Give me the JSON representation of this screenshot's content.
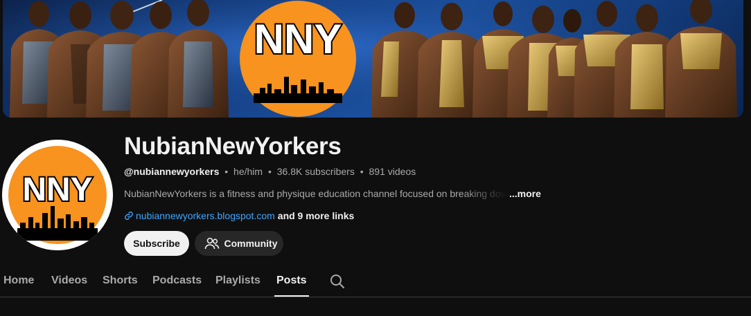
{
  "banner": {
    "logo_text": "NNY",
    "colors": {
      "sky": "#1c55a8",
      "logo_orange": "#f7931e"
    }
  },
  "avatar": {
    "logo_text": "NNY",
    "colors": {
      "logo_orange": "#f7931e"
    }
  },
  "channel": {
    "title": "NubianNewYorkers",
    "handle": "@nubiannewyorkers",
    "pronouns": "he/him",
    "subscribers": "36.8K subscribers",
    "videos": "891 videos",
    "separator": "•",
    "description": "NubianNewYorkers is a fitness and physique education channel focused on breaking down",
    "more_label": "...more",
    "link_url": "nubiannewyorkers.blogspot.com",
    "more_links": "and 9 more links"
  },
  "buttons": {
    "subscribe": "Subscribe",
    "community": "Community"
  },
  "tabs": [
    {
      "label": "Home",
      "active": false
    },
    {
      "label": "Videos",
      "active": false
    },
    {
      "label": "Shorts",
      "active": false
    },
    {
      "label": "Podcasts",
      "active": false
    },
    {
      "label": "Playlists",
      "active": false
    },
    {
      "label": "Posts",
      "active": true
    }
  ],
  "icons": {
    "link": "link-icon",
    "community": "people-icon",
    "search": "search-icon"
  }
}
